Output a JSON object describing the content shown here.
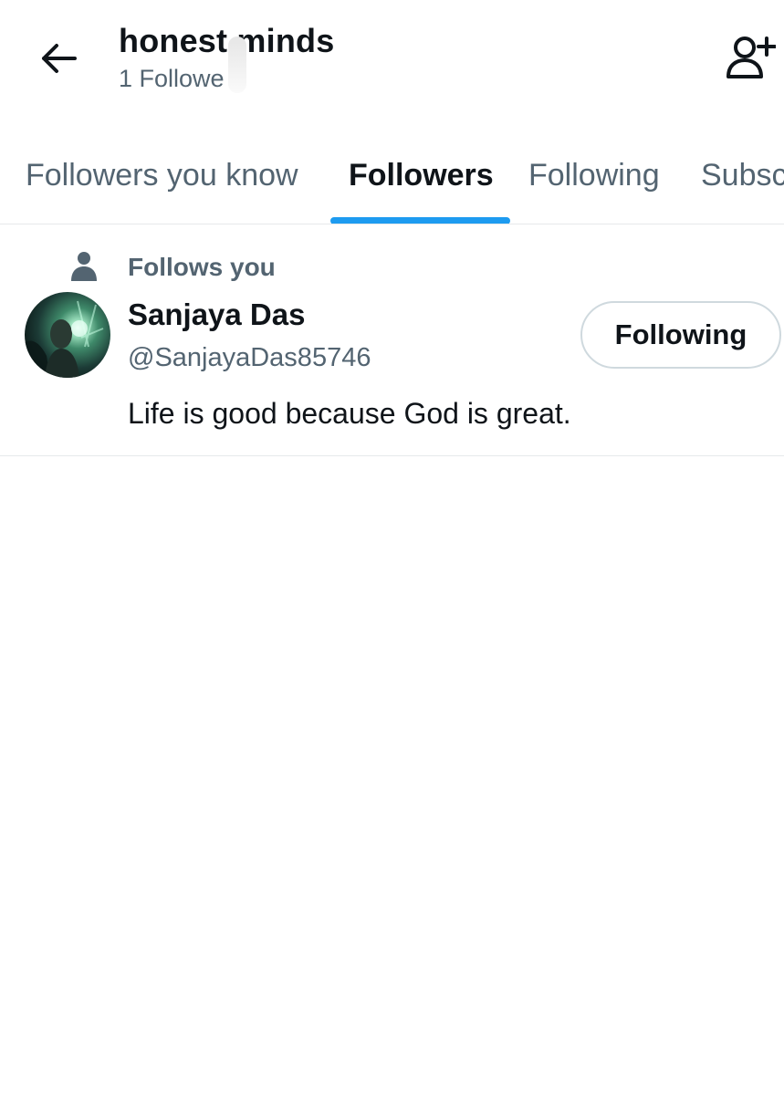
{
  "header": {
    "title": "honest minds",
    "subtitle": "1 Followe",
    "back_icon": "arrow-left-icon",
    "add_user_icon": "person-plus-icon"
  },
  "tabs": [
    {
      "label": "Followers you know",
      "active": false
    },
    {
      "label": "Followers",
      "active": true
    },
    {
      "label": "Following",
      "active": false
    },
    {
      "label": "Subsc",
      "active": false
    }
  ],
  "colors": {
    "accent": "#1d9bf0",
    "text_primary": "#0f1419",
    "text_secondary": "#536471",
    "border": "#e6e9eb"
  },
  "users": [
    {
      "follows_you": "Follows you",
      "follows_you_icon": "person-icon",
      "name": "Sanjaya Das",
      "handle": "@SanjayaDas85746",
      "bio": "Life is good because God is great.",
      "button_label": "Following"
    }
  ]
}
